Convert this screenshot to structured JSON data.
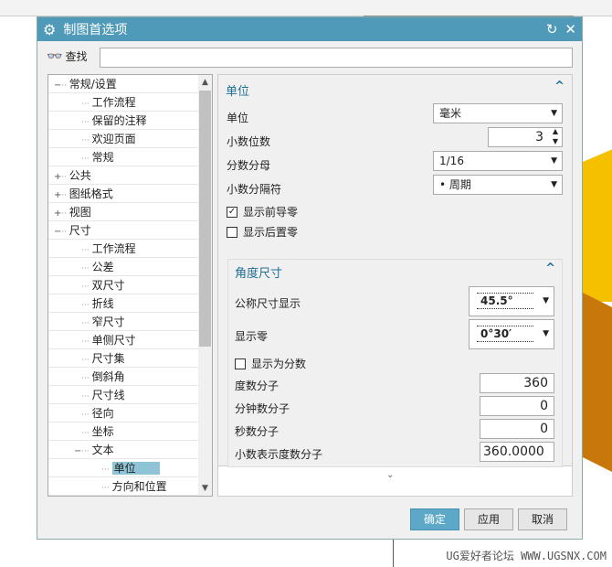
{
  "dialog": {
    "title": "制图首选项"
  },
  "find": {
    "label": "查找",
    "value": ""
  },
  "tree": [
    {
      "label": "常规/设置",
      "level": 0,
      "exp": "−"
    },
    {
      "label": "工作流程",
      "level": 1
    },
    {
      "label": "保留的注释",
      "level": 1
    },
    {
      "label": "欢迎页面",
      "level": 1
    },
    {
      "label": "常规",
      "level": 1
    },
    {
      "label": "公共",
      "level": 0,
      "exp": "+"
    },
    {
      "label": "图纸格式",
      "level": 0,
      "exp": "+"
    },
    {
      "label": "视图",
      "level": 0,
      "exp": "+"
    },
    {
      "label": "尺寸",
      "level": 0,
      "exp": "−"
    },
    {
      "label": "工作流程",
      "level": 1
    },
    {
      "label": "公差",
      "level": 1
    },
    {
      "label": "双尺寸",
      "level": 1
    },
    {
      "label": "折线",
      "level": 1
    },
    {
      "label": "窄尺寸",
      "level": 1
    },
    {
      "label": "单侧尺寸",
      "level": 1
    },
    {
      "label": "尺寸集",
      "level": 1
    },
    {
      "label": "倒斜角",
      "level": 1
    },
    {
      "label": "尺寸线",
      "level": 1
    },
    {
      "label": "径向",
      "level": 1
    },
    {
      "label": "坐标",
      "level": 1
    },
    {
      "label": "文本",
      "level": 1,
      "exp": "−"
    },
    {
      "label": "单位",
      "level": 2,
      "selected": true
    },
    {
      "label": "方向和位置",
      "level": 2
    }
  ],
  "units": {
    "header": "单位",
    "unit_label": "单位",
    "unit_value": "毫米",
    "decimals_label": "小数位数",
    "decimals_value": "3",
    "fraction_label": "分数分母",
    "fraction_value": "1/16",
    "sep_label": "小数分隔符",
    "sep_value": "• 周期",
    "leading_zero": {
      "label": "显示前导零",
      "checked": true
    },
    "trailing_zero": {
      "label": "显示后置零",
      "checked": false
    }
  },
  "angular": {
    "header": "角度尺寸",
    "nominal_label": "公称尺寸显示",
    "nominal_value": "45.5°",
    "zero_label": "显示零",
    "zero_value": "0°30′",
    "as_fraction": {
      "label": "显示为分数",
      "checked": false
    },
    "deg_num_label": "度数分子",
    "deg_num": "360",
    "min_num_label": "分钟数分子",
    "min_num": "0",
    "sec_num_label": "秒数分子",
    "sec_num": "0",
    "dec_deg_label": "小数表示度数分子",
    "dec_deg": "360.0000"
  },
  "buttons": {
    "ok": "确定",
    "apply": "应用",
    "cancel": "取消"
  },
  "watermark": "UG爱好者论坛 WWW.UGSNX.COM"
}
